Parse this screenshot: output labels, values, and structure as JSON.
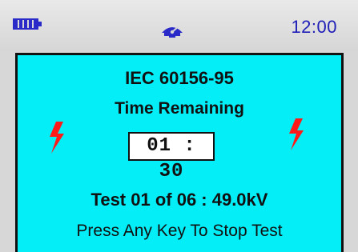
{
  "status_bar": {
    "battery_icon": "battery-full-icon",
    "center_icon": "meter-icon",
    "time": "12:00"
  },
  "screen": {
    "title": "IEC 60156-95",
    "subtitle": "Time Remaining",
    "timer": "01 : 30",
    "left_icon": "lightning-icon",
    "right_icon": "lightning-icon",
    "test_line": "Test 01 of 06 :  49.0kV",
    "instruction": "Press Any Key To Stop Test"
  },
  "colors": {
    "screen_bg": "#04eef8",
    "bolt": "#ff1a1a",
    "clock": "#2020b8"
  }
}
